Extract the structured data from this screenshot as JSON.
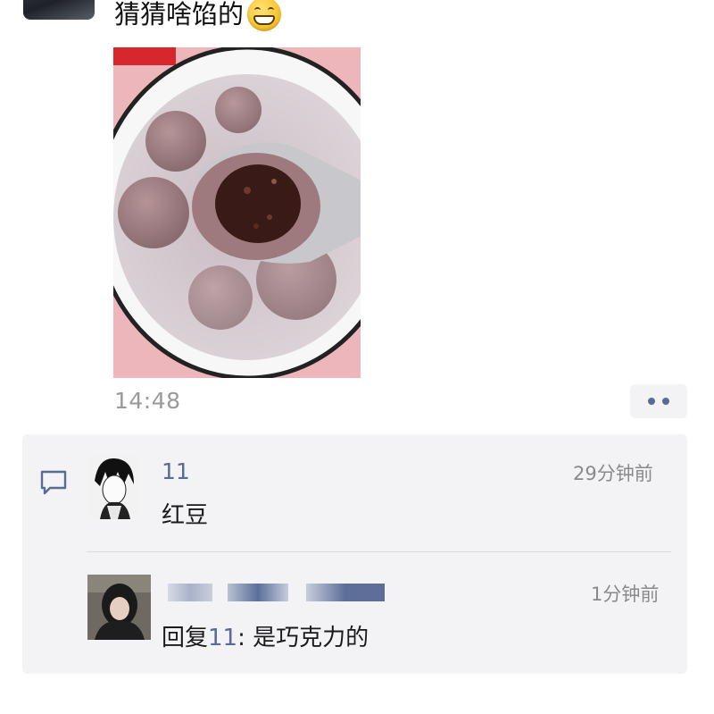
{
  "post": {
    "text": "猜猜啥馅的",
    "emoji_icon": "grinning-face-icon",
    "time": "14:48"
  },
  "comments": [
    {
      "author": "11",
      "time": "29分钟前",
      "text": "红豆"
    },
    {
      "author": "",
      "time": "1分钟前",
      "reply_prefix": "回复",
      "reply_to": "11",
      "reply_sep": ":",
      "text": " 是巧克力的"
    }
  ],
  "colors": {
    "link": "#576b95",
    "panel": "#f3f3f5",
    "timestamp": "#9a9a9a"
  }
}
